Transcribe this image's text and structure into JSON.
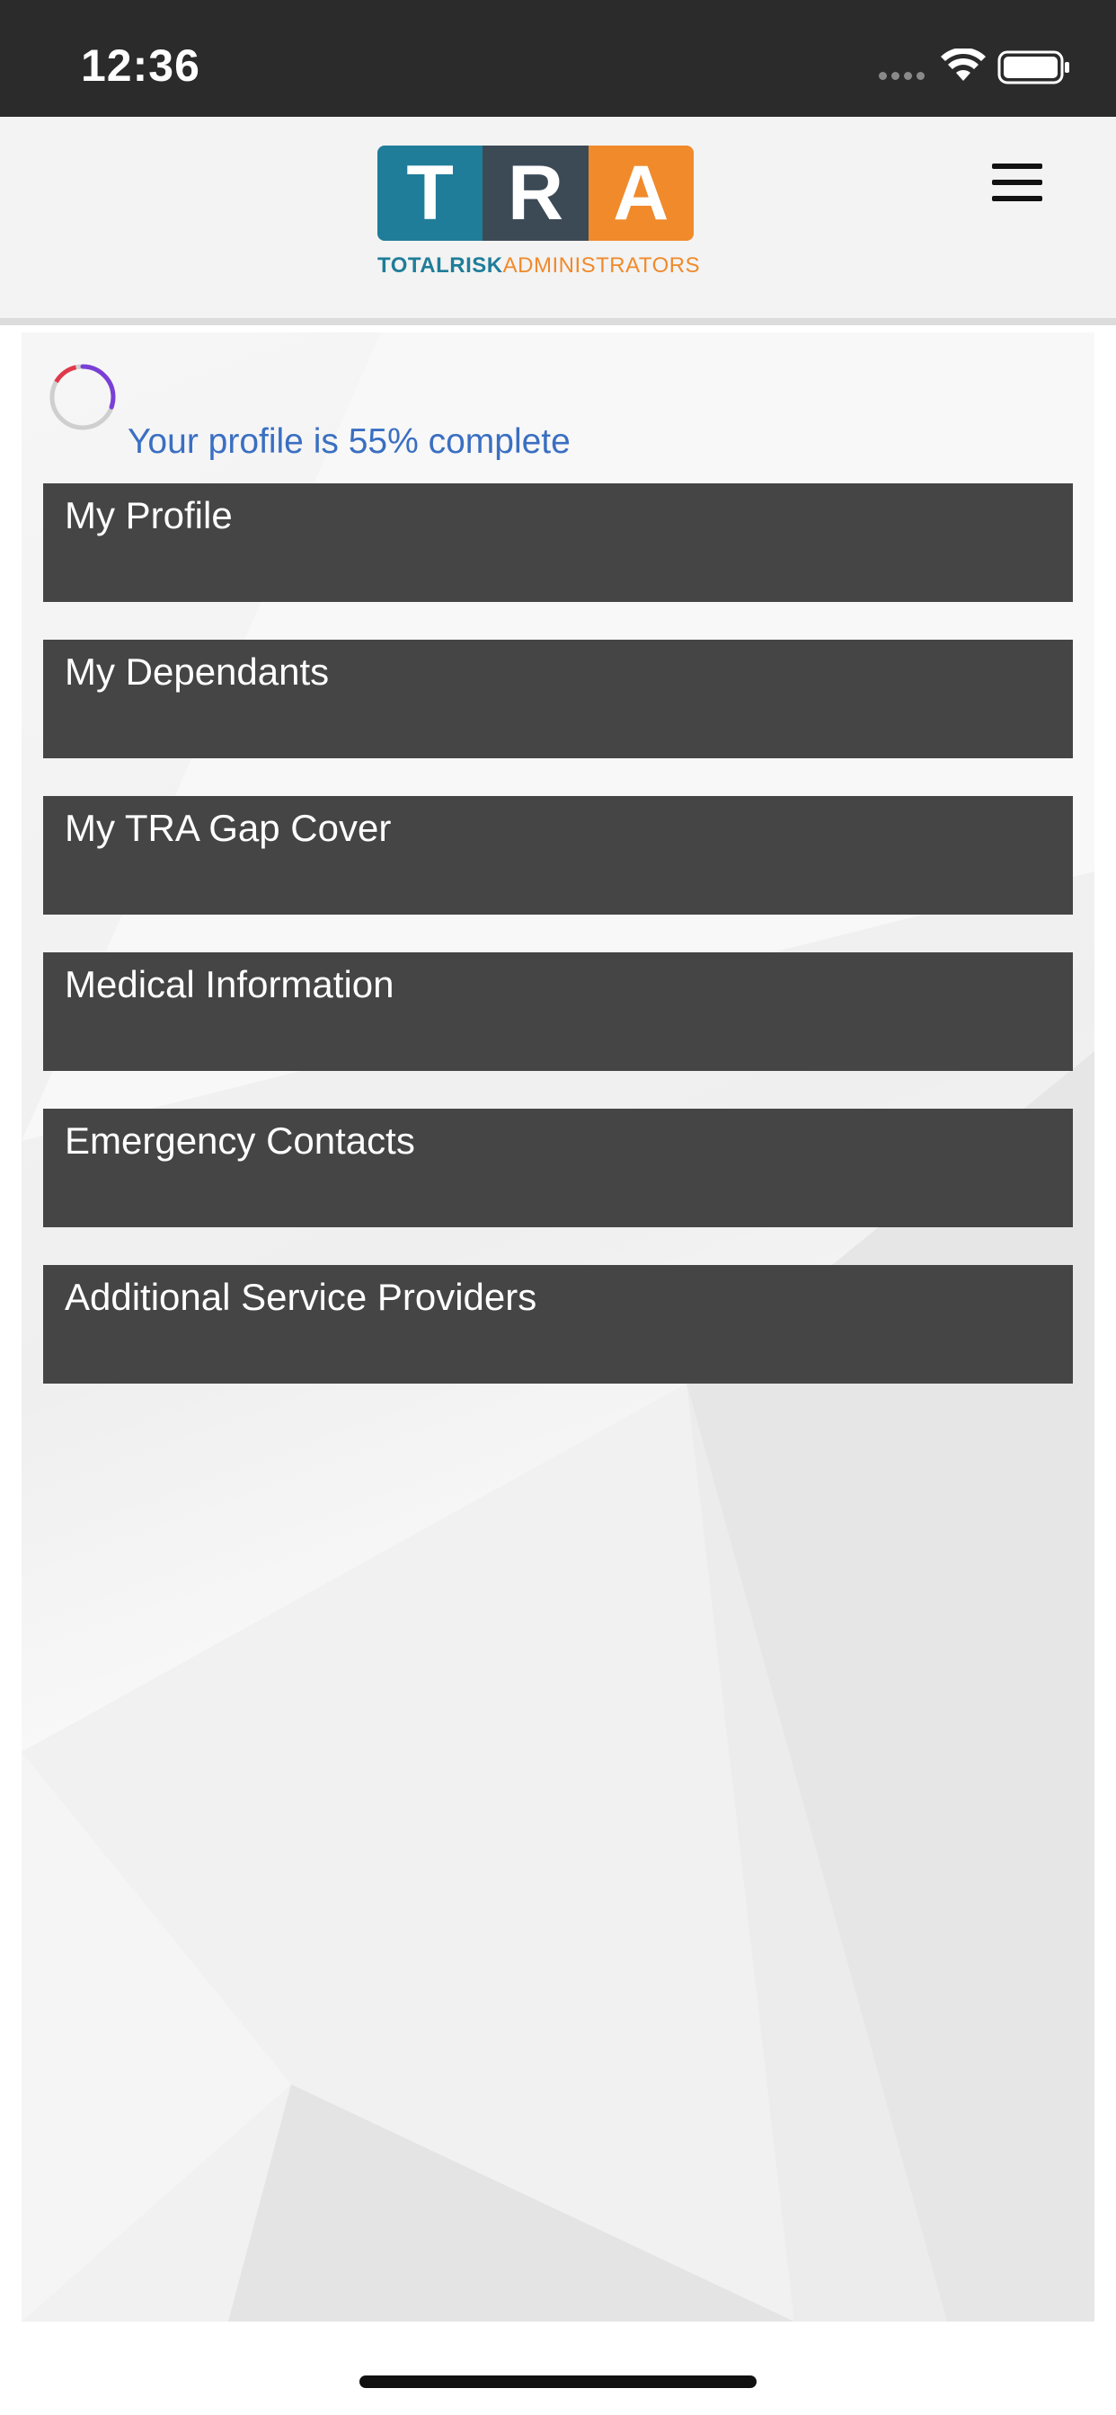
{
  "status_bar": {
    "time": "12:36",
    "icons": [
      "signal-dots-icon",
      "wifi-icon",
      "battery-icon"
    ]
  },
  "header": {
    "logo": {
      "tiles": [
        "T",
        "R",
        "A"
      ],
      "tagline_total": "TOTAL",
      "tagline_risk": "RISK",
      "tagline_admin": "ADMINISTRATORS"
    },
    "menu_icon": "hamburger-menu-icon"
  },
  "profile_progress": {
    "text": "Your profile is 55% complete",
    "percent": 55
  },
  "menu": {
    "items": [
      {
        "label": "My Profile"
      },
      {
        "label": "My Dependants"
      },
      {
        "label": "My TRA Gap Cover"
      },
      {
        "label": "Medical Information"
      },
      {
        "label": "Emergency Contacts"
      },
      {
        "label": "Additional Service Providers"
      }
    ]
  },
  "colors": {
    "status_bar": "#2b2b2b",
    "header_bg": "#f3f3f3",
    "menu_item_bg": "#454545",
    "progress_text": "#3a6fc2",
    "logo_teal": "#1f7d99",
    "logo_slate": "#3c4a56",
    "logo_orange": "#f08a2b"
  }
}
